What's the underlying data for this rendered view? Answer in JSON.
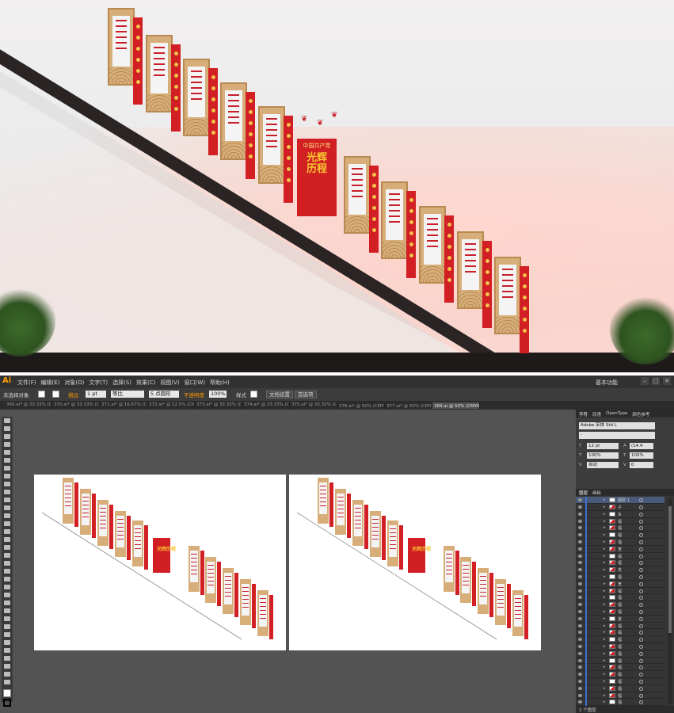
{
  "render": {
    "slogan_small": "中国共产党",
    "slogan_main": "光辉历程"
  },
  "app": {
    "logo": "Ai",
    "menus": [
      "文件(F)",
      "编辑(E)",
      "对象(O)",
      "文字(T)",
      "选择(S)",
      "效果(C)",
      "视图(V)",
      "窗口(W)",
      "帮助(H)"
    ],
    "workspace": "基本功能",
    "window_buttons": [
      "–",
      "□",
      "✕"
    ]
  },
  "control": {
    "selection": "未选择对象",
    "stroke_label": "描边",
    "stroke_value": "1 pt",
    "stroke_style": "等比",
    "brush": "5 点圆形",
    "opacity_label": "不透明度",
    "opacity_value": "100%",
    "style_label": "样式",
    "doc_setup": "文档设置",
    "prefs": "首选项"
  },
  "tabs": [
    "369.ai* @ 33.33% (CMYK...",
    "370.ai* @ 33.33% (CMYK...",
    "371.ai* @ 16.67% (CMYK...",
    "372.ai* @ 12.5% (CMYK/...",
    "373.ai* @ 33.33% (CMYK...",
    "374.ai* @ 33.33% (CMYK...",
    "375.ai* @ 33.33% (CMYK...",
    "376.ai* @ 50% (CMYK/预...",
    "377.ai* @ 50% (CMYK/预...",
    "369.ai @ 50% (CMYK/预览)"
  ],
  "character": {
    "tabs": [
      "字符",
      "段落",
      "OpenType",
      "颜色参考"
    ],
    "font": "Adobe 宋体 Std L",
    "style": "-",
    "size": "12 pt",
    "leading": "(14.4",
    "h_scale": "100%",
    "v_scale": "100%",
    "tracking": "自动",
    "kerning": "0"
  },
  "layers": {
    "tabs": [
      "图层",
      "画板"
    ],
    "top_layer": "图层 1",
    "items": [
      "子",
      "永",
      "福",
      "福",
      "福",
      "福",
      "宽",
      "福",
      "福",
      "发",
      "福",
      "宽",
      "福",
      "福",
      "福",
      "福",
      "置",
      "福",
      "福",
      "福",
      "福",
      "福",
      "福",
      "福",
      "福",
      "福",
      "福",
      "福",
      "福",
      "福"
    ],
    "footer": "1 个图层"
  }
}
